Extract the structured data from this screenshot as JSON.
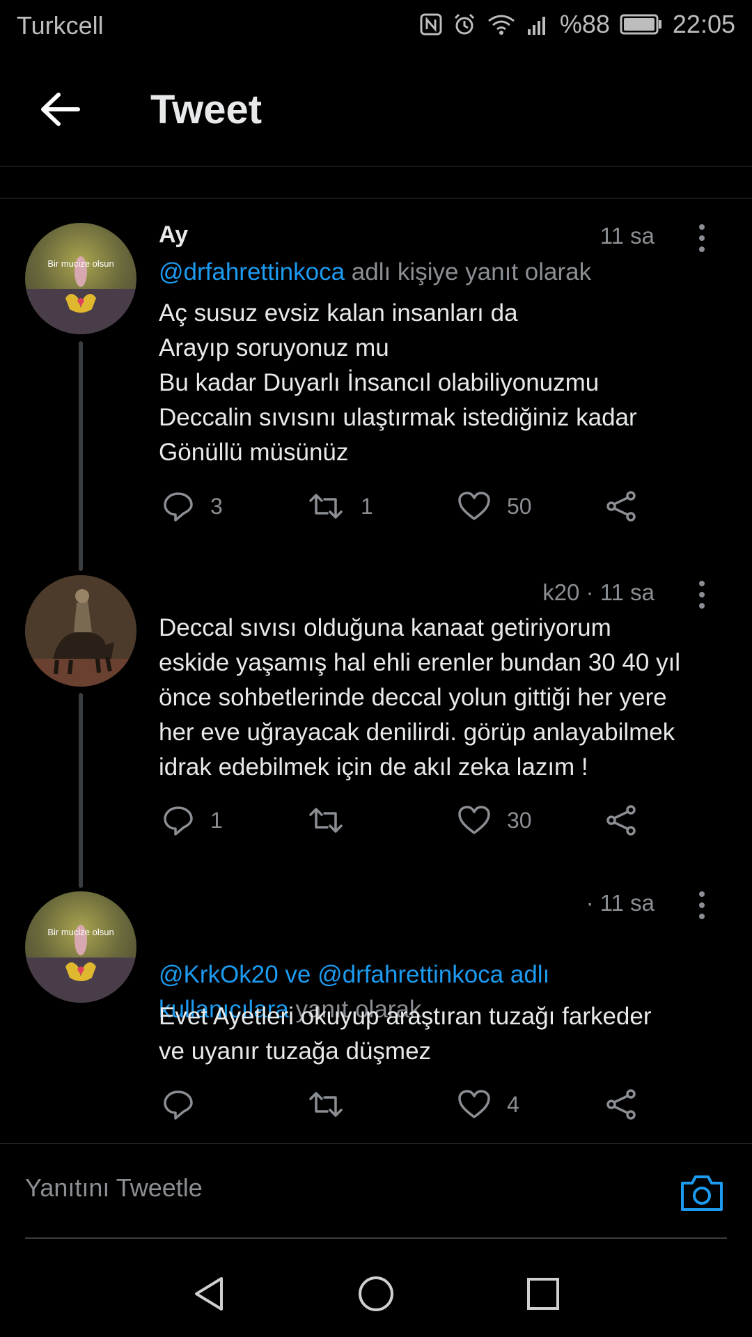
{
  "status_bar": {
    "carrier": "Turkcell",
    "battery": "%88",
    "time": "22:05",
    "icons": [
      "nfc-icon",
      "alarm-icon",
      "wifi-icon",
      "signal-icon",
      "battery-icon"
    ]
  },
  "app_bar": {
    "title": "Tweet",
    "back_icon": "arrow-left-icon"
  },
  "accent_color": "#1d9bf0",
  "tweets": [
    {
      "name": "Ay",
      "time": "11 sa",
      "replying_mentions": "@drfahrettinkoca",
      "replying_suffix": " adlı kişiye yanıt olarak",
      "text": "Aç susuz evsiz kalan insanları da\nArayıp soruyonuz mu\nBu kadar Duyarlı  İnsancıl olabiliyonuzmu\nDeccalin sıvısını ulaştırmak istediğiniz kadar\nGönüllü müsünüz",
      "reply_count": "3",
      "retweet_count": "1",
      "like_count": "50",
      "avatar_text": "Bir mucize olsun"
    },
    {
      "name": "",
      "time": "k20 · 11 sa",
      "text": "Deccal sıvısı olduğuna kanaat getiriyorum\neskide yaşamış hal ehli erenler bundan 30 40 yıl\nönce sohbetlerinde deccal yolun gittiği her yere\nher eve uğrayacak denilirdi. görüp anlayabilmek\nidrak edebilmek için de akıl zeka lazım !",
      "reply_count": "1",
      "retweet_count": "",
      "like_count": "30"
    },
    {
      "name": "",
      "time": "· 11 sa",
      "replying_mentions": "@KrkOk20 ve @drfahrettinkoca adlı\nkullanıcılara",
      "replying_suffix": " yanıt olarak",
      "text": "Evet  Ayetleri okuyup araştıran tuzağı farkeder\nve uyanır tuzağa düşmez",
      "reply_count": "",
      "retweet_count": "",
      "like_count": "4",
      "avatar_text": "Bir mucize olsun"
    }
  ],
  "reply_box": {
    "placeholder": "Yanıtını Tweetle",
    "camera_icon": "camera-icon"
  },
  "nav_bar": {
    "icons": [
      "back-triangle-icon",
      "home-circle-icon",
      "recents-square-icon"
    ]
  }
}
